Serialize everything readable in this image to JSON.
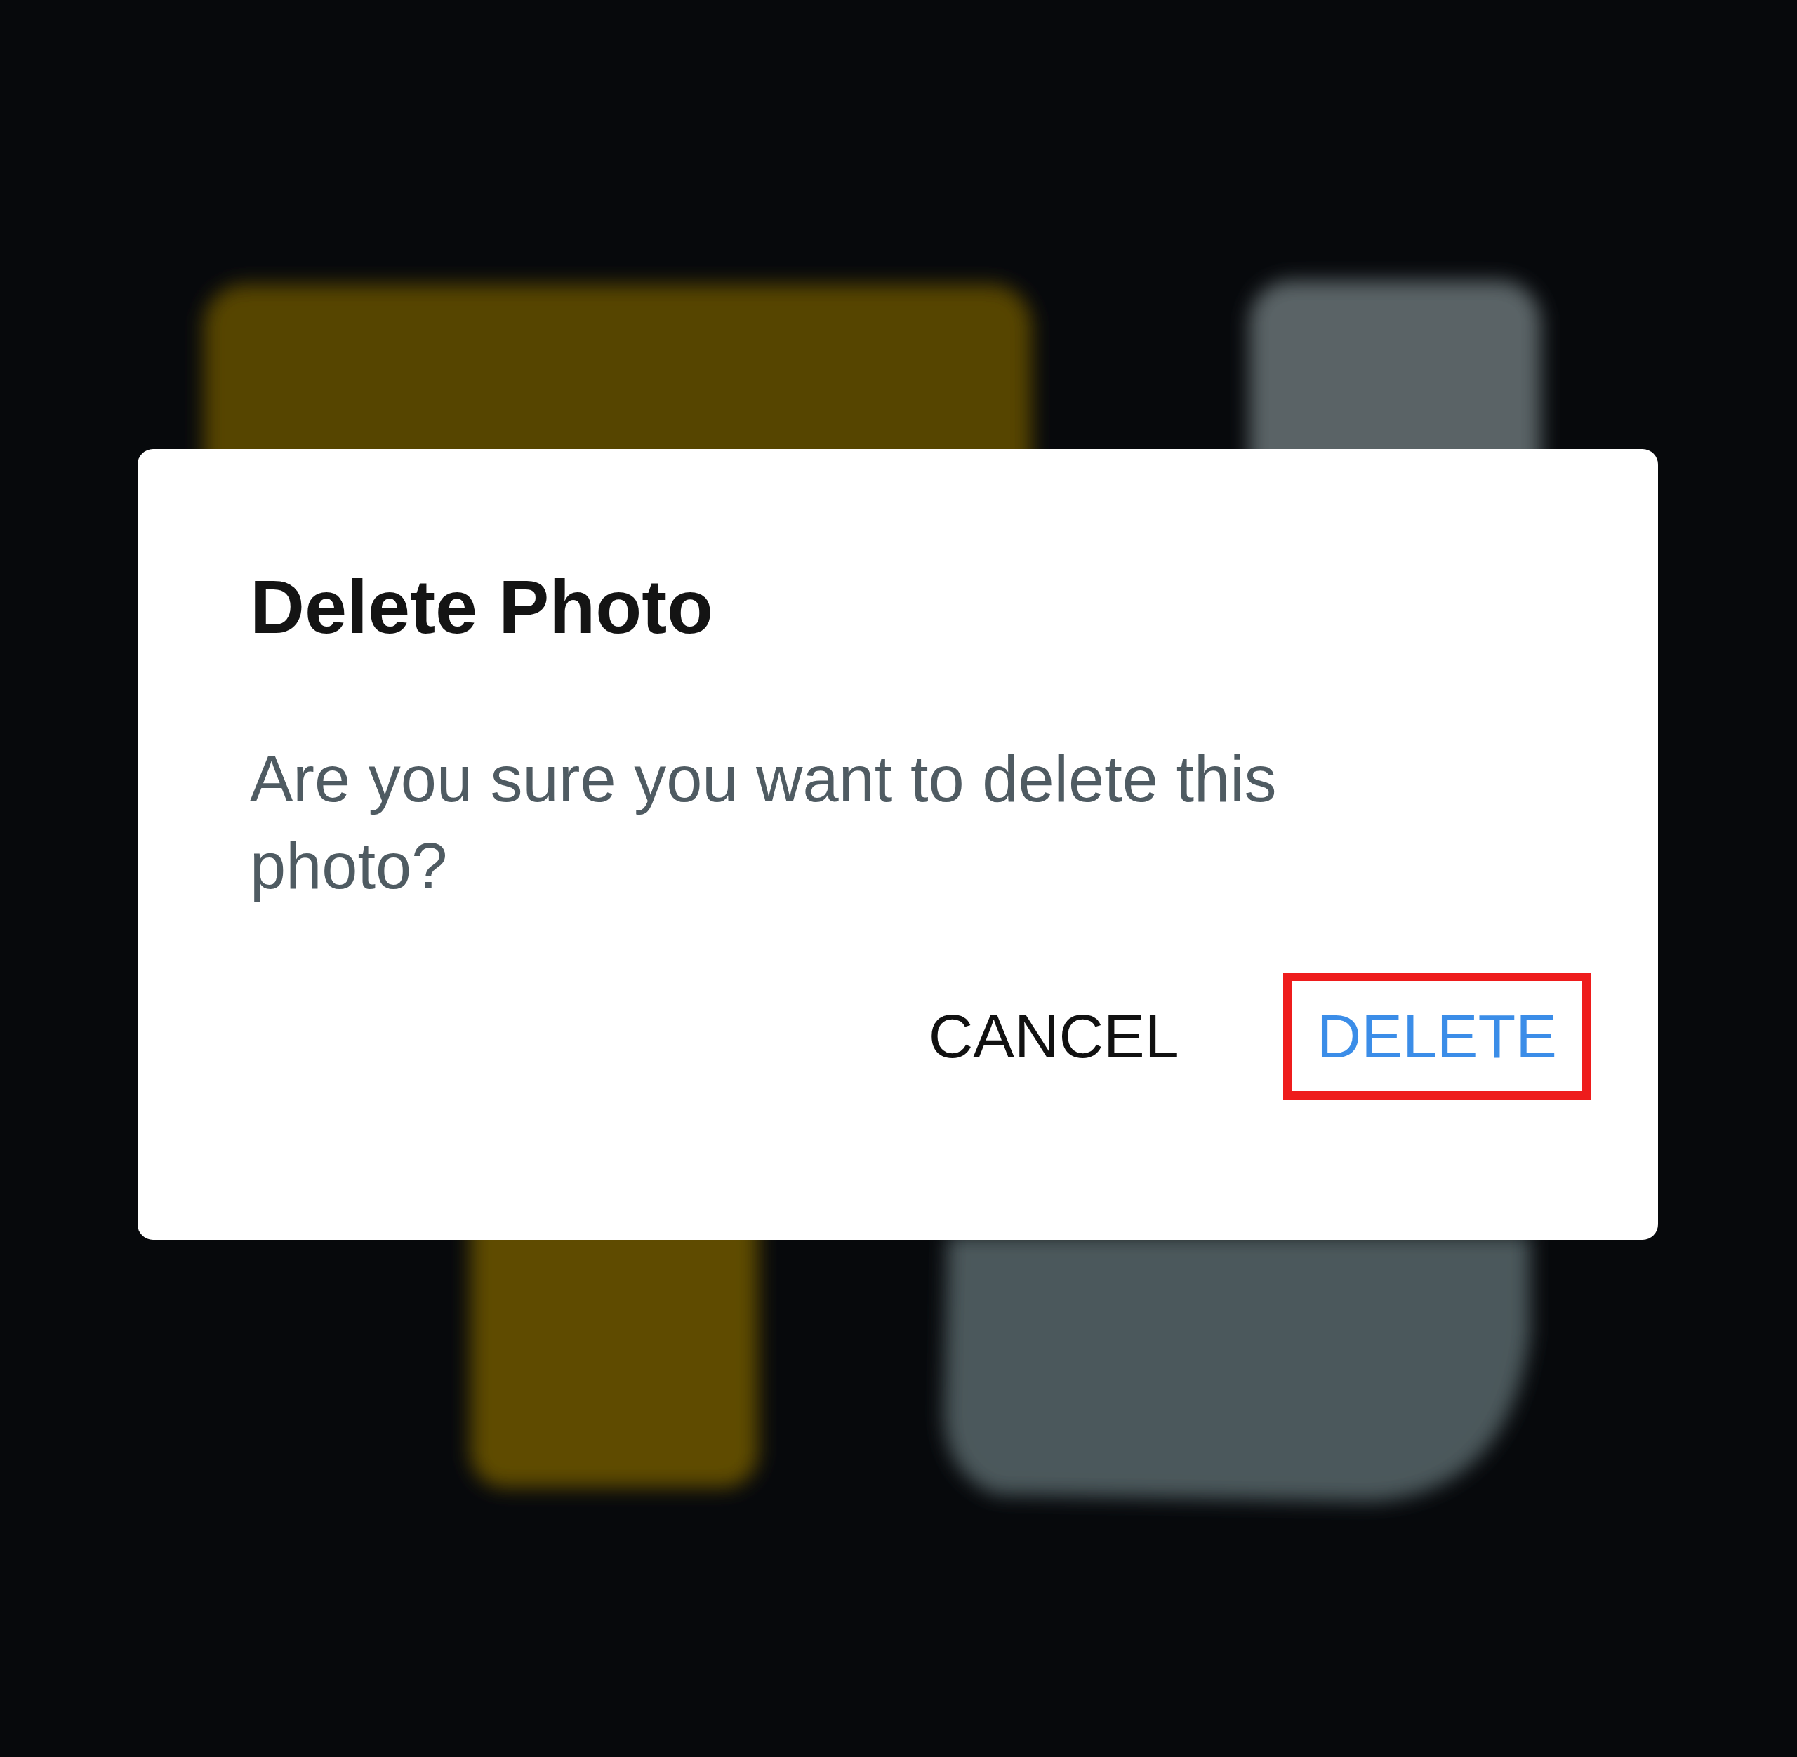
{
  "dialog": {
    "title": "Delete Photo",
    "message": "Are you sure you want to delete this photo?",
    "buttons": [
      {
        "label": "CANCEL",
        "kind": "neutral",
        "highlighted": false
      },
      {
        "label": "DELETE",
        "kind": "primary",
        "highlighted": true
      }
    ]
  }
}
